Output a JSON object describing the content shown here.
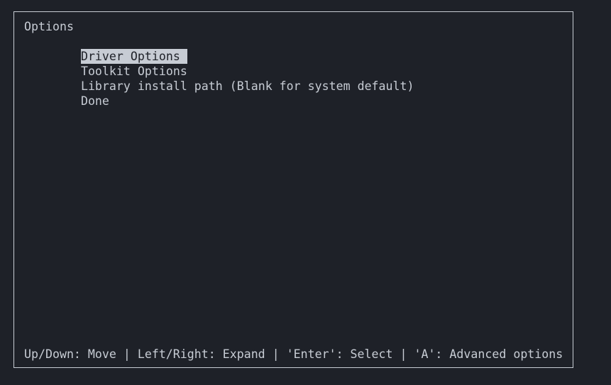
{
  "panel": {
    "title": "Options"
  },
  "menu": {
    "items": [
      {
        "label": "Driver Options",
        "selected": true
      },
      {
        "label": "Toolkit Options",
        "selected": false
      },
      {
        "label": "Library install path (Blank for system default)",
        "selected": false
      },
      {
        "label": "Done",
        "selected": false
      }
    ]
  },
  "footer": {
    "help_text": "Up/Down: Move | Left/Right: Expand | 'Enter': Select | 'A': Advanced options"
  },
  "colors": {
    "background": "#1e2128",
    "foreground": "#c7ccd4",
    "selection_background": "#c7ccd4",
    "selection_foreground": "#1e2128"
  }
}
